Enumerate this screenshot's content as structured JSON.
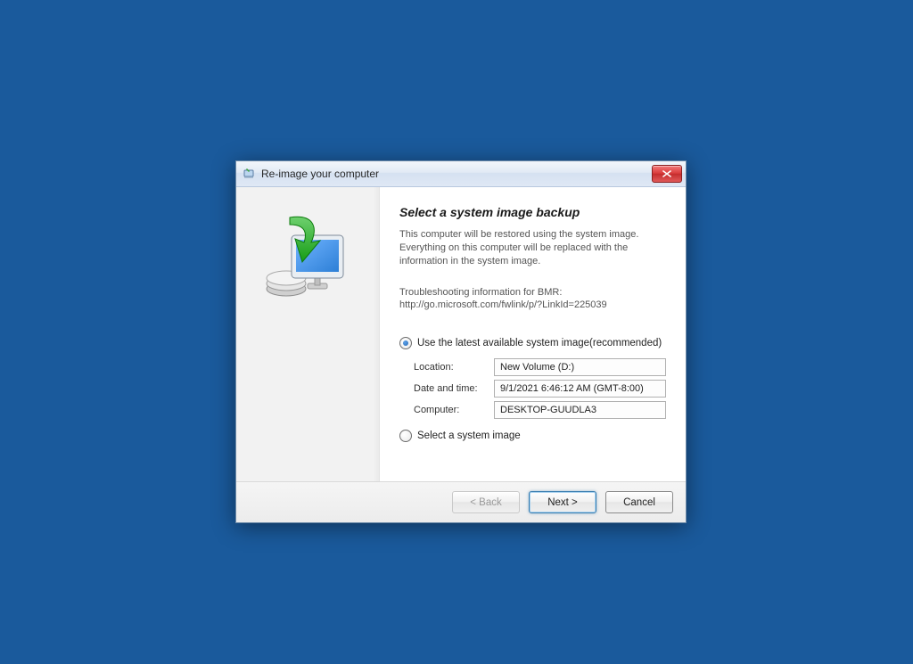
{
  "window": {
    "title": "Re-image your computer"
  },
  "main": {
    "heading": "Select a system image backup",
    "description": "This computer will be restored using the system image. Everything on this computer will be replaced with the information in the system image.",
    "troubleshoot_label": "Troubleshooting information for BMR:",
    "troubleshoot_link": "http://go.microsoft.com/fwlink/p/?LinkId=225039",
    "radio_latest": "Use the latest available system image(recommended)",
    "radio_select": "Select a system image",
    "details": {
      "location_label": "Location:",
      "location_value": "New Volume (D:)",
      "datetime_label": "Date and time:",
      "datetime_value": "9/1/2021 6:46:12 AM (GMT-8:00)",
      "computer_label": "Computer:",
      "computer_value": "DESKTOP-GUUDLA3"
    }
  },
  "footer": {
    "back": "< Back",
    "next": "Next >",
    "cancel": "Cancel"
  }
}
